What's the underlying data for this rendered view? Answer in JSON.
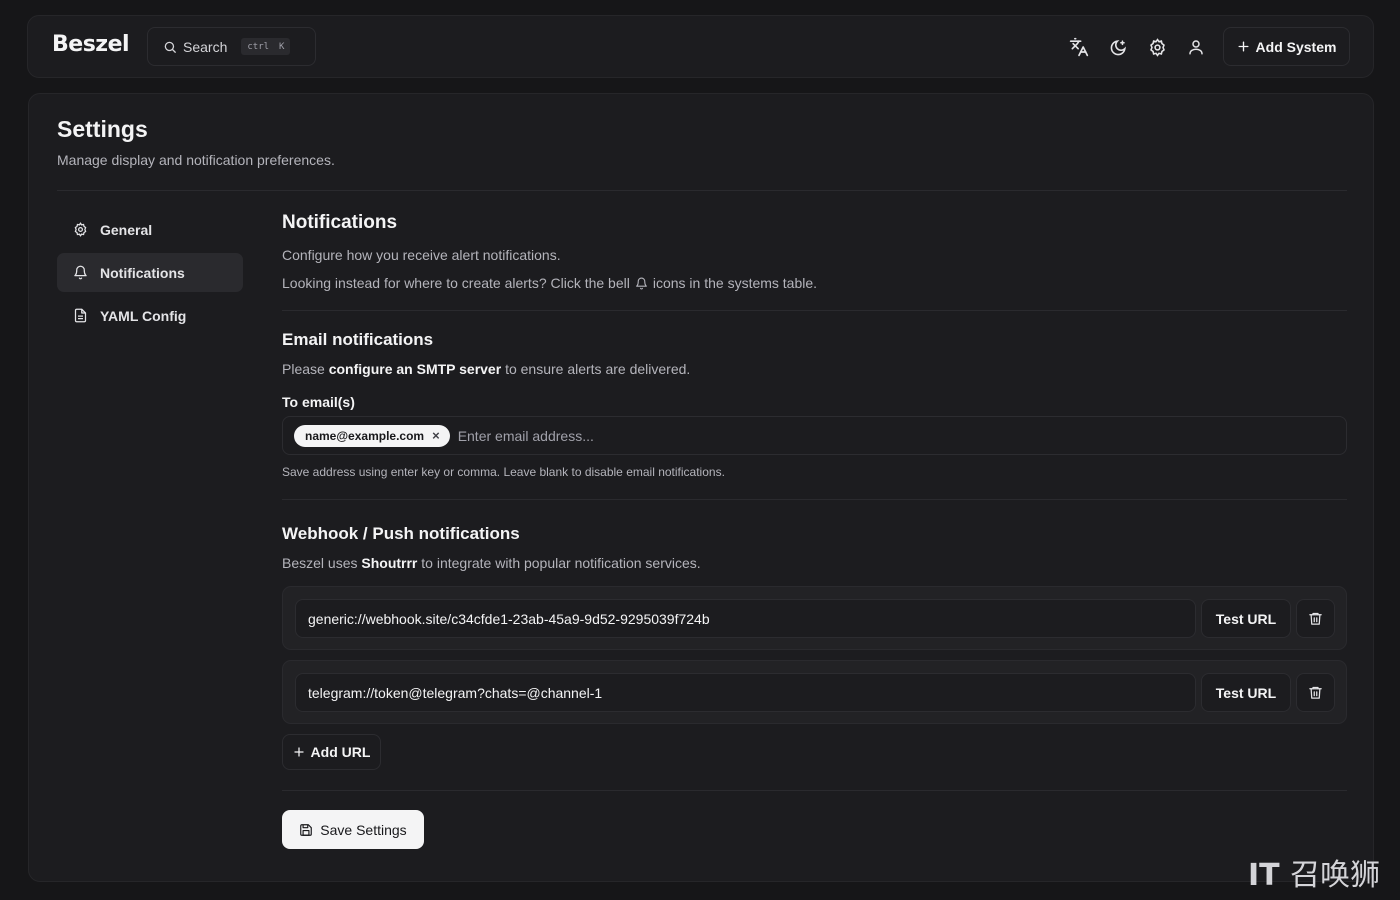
{
  "header": {
    "logo": "Beszel",
    "search": {
      "label": "Search",
      "kbd_ctrl": "ctrl",
      "kbd_key": "K"
    },
    "icons": [
      "translate-icon",
      "theme-toggle-icon",
      "settings-gear-icon",
      "user-icon"
    ],
    "add_system_label": "Add System"
  },
  "page": {
    "title": "Settings",
    "subtitle": "Manage display and notification preferences."
  },
  "sidebar": {
    "items": [
      {
        "label": "General",
        "icon": "gear-icon",
        "active": false
      },
      {
        "label": "Notifications",
        "icon": "bell-icon",
        "active": true
      },
      {
        "label": "YAML Config",
        "icon": "file-icon",
        "active": false
      }
    ]
  },
  "notifications": {
    "title": "Notifications",
    "desc1": "Configure how you receive alert notifications.",
    "desc2_pre": "Looking instead for where to create alerts? Click the bell",
    "desc2_post": "icons in the systems table."
  },
  "email": {
    "title": "Email notifications",
    "desc_pre": "Please",
    "desc_bold": "configure an SMTP server",
    "desc_post": "to ensure alerts are delivered.",
    "label": "To email(s)",
    "chip": "name@example.com",
    "chip_remove": "×",
    "placeholder": "Enter email address...",
    "help": "Save address using enter key or comma. Leave blank to disable email notifications."
  },
  "webhook": {
    "title": "Webhook / Push notifications",
    "desc_pre": "Beszel uses",
    "desc_bold": "Shoutrrr",
    "desc_post": "to integrate with popular notification services.",
    "urls": [
      "generic://webhook.site/c34cfde1-23ab-45a9-9d52-9295039f724b",
      "telegram://token@telegram?chats=@channel-1"
    ],
    "test_label": "Test URL",
    "add_url_label": "Add URL"
  },
  "save_label": "Save Settings",
  "watermark": {
    "latin": "IT",
    "cjk": "召唤狮"
  }
}
